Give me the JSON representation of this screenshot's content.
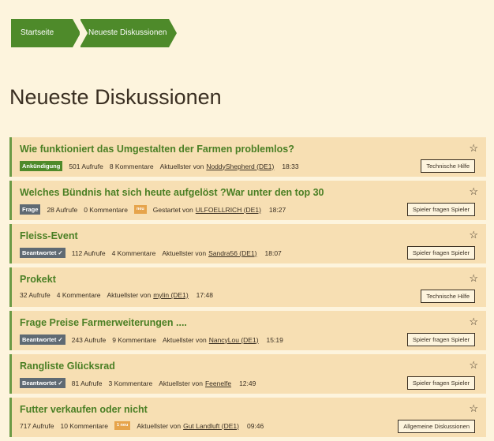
{
  "breadcrumb": {
    "home": "Startseite",
    "current": "Neueste Diskussionen"
  },
  "page": {
    "title": "Neueste Diskussionen"
  },
  "discussions": [
    {
      "title": "Wie funktioniert das Umgestalten der Farmen problemlos?",
      "badge": "Ankündigung",
      "badge_color": "#4e8a2a",
      "views": "501 Aufrufe",
      "comments": "8 Kommentare",
      "new": "",
      "action": "Aktuellster von",
      "user": "NoddyShepherd (DE1)",
      "time": "18:33",
      "category": "Technische Hilfe"
    },
    {
      "title": "Welches Bündnis hat sich heute aufgelöst ?War unter den top 30",
      "badge": "Frage",
      "badge_color": "#5f6a73",
      "views": "28 Aufrufe",
      "comments": "0 Kommentare",
      "new": "neu",
      "action": "Gestartet von",
      "user": "ULFOELLRICH (DE1)",
      "time": "18:27",
      "category": "Spieler fragen Spieler"
    },
    {
      "title": "Fleiss-Event",
      "badge": "Beantwortet ✓",
      "badge_color": "#5f6a73",
      "views": "112 Aufrufe",
      "comments": "4 Kommentare",
      "new": "",
      "action": "Aktuellster von",
      "user": "Sandra56 (DE1)",
      "time": "18:07",
      "category": "Spieler fragen Spieler"
    },
    {
      "title": "Prokekt",
      "badge": "",
      "badge_color": "",
      "views": "32 Aufrufe",
      "comments": "4 Kommentare",
      "new": "",
      "action": "Aktuellster von",
      "user": "mylin (DE1)",
      "time": "17:48",
      "category": "Technische Hilfe"
    },
    {
      "title": "Frage Preise Farmerweiterungen ....",
      "badge": "Beantwortet ✓",
      "badge_color": "#5f6a73",
      "views": "243 Aufrufe",
      "comments": "9 Kommentare",
      "new": "",
      "action": "Aktuellster von",
      "user": "NancyLou (DE1)",
      "time": "15:19",
      "category": "Spieler fragen Spieler"
    },
    {
      "title": "Rangliste Glücksrad",
      "badge": "Beantwortet ✓",
      "badge_color": "#5f6a73",
      "views": "81 Aufrufe",
      "comments": "3 Kommentare",
      "new": "",
      "action": "Aktuellster von",
      "user": "Feenelfe",
      "time": "12:49",
      "category": "Spieler fragen Spieler"
    },
    {
      "title": "Futter verkaufen oder nicht",
      "badge": "",
      "badge_color": "",
      "views": "717 Aufrufe",
      "comments": "10 Kommentare",
      "new": "1 neu",
      "action": "Aktuellster von",
      "user": "Gut Landluft (DE1)",
      "time": "09:46",
      "category": "Allgemeine Diskussionen"
    }
  ],
  "colors": {
    "background": "#fdf4dd",
    "card": "#f7dfb3",
    "accent": "#4e8a2a",
    "new_badge": "#e6a44b"
  },
  "icons": {
    "favorite": "star-outline-icon"
  }
}
